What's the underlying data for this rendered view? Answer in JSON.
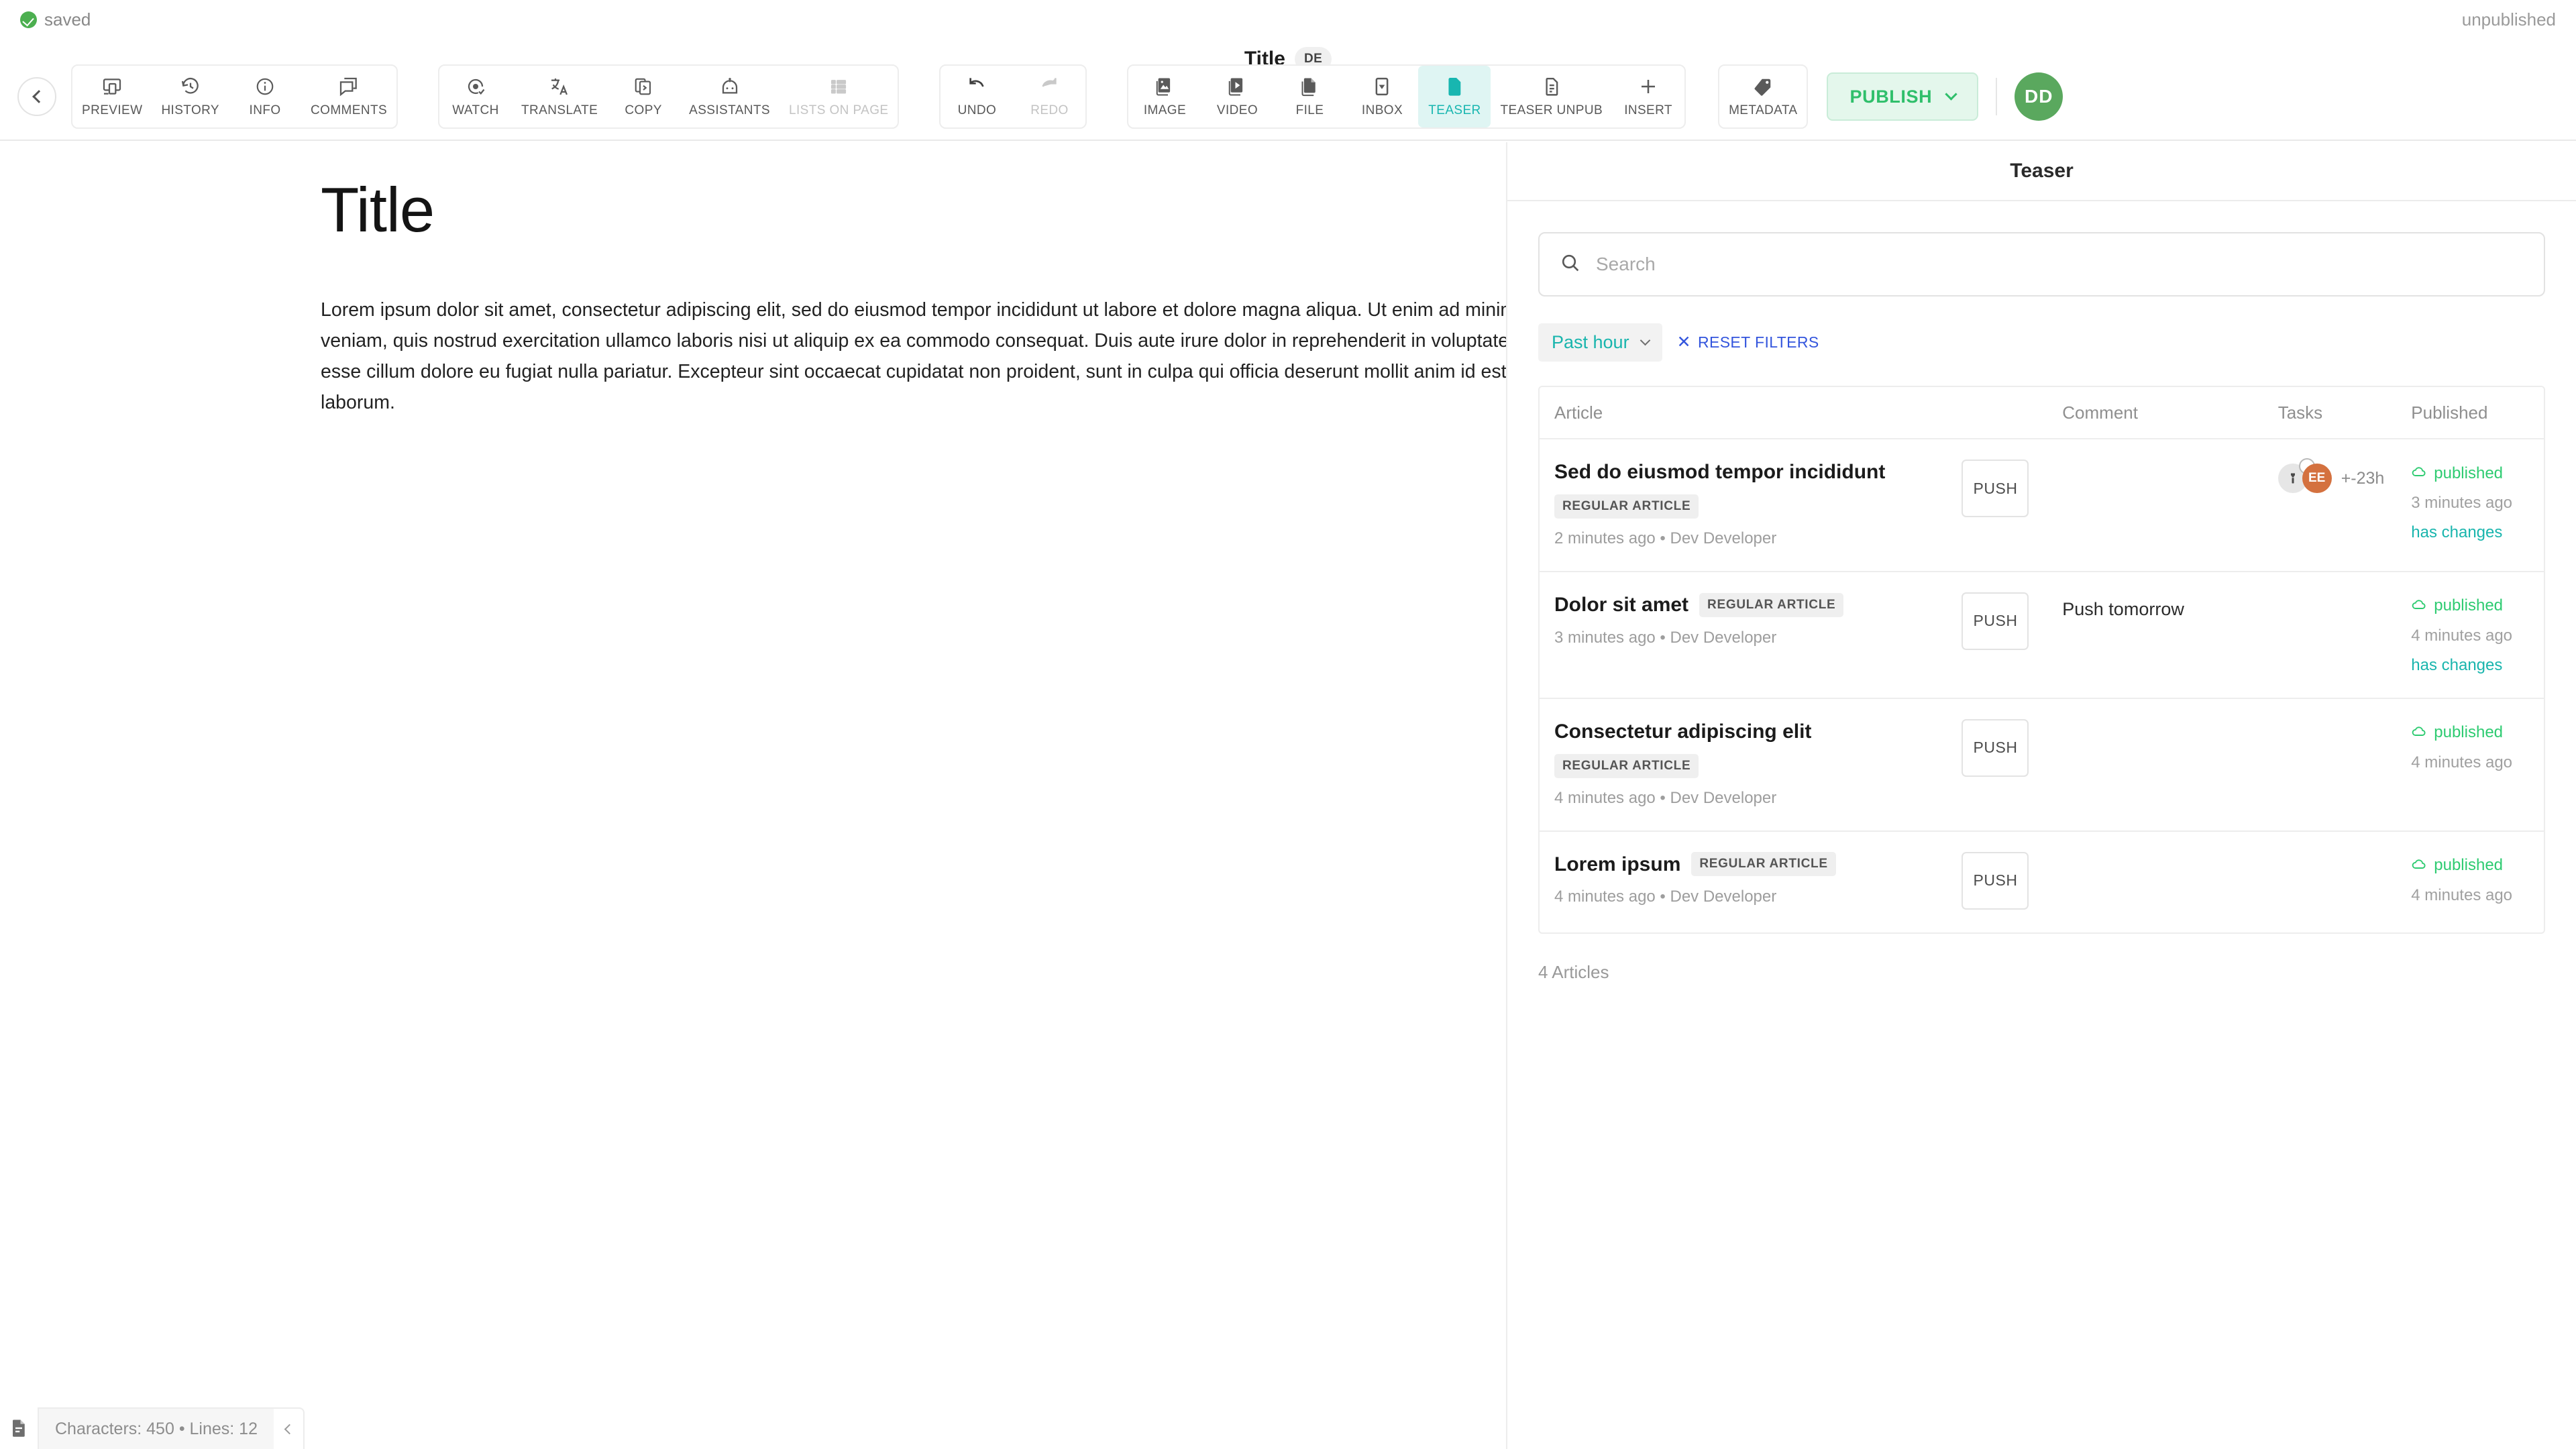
{
  "status": {
    "saved_label": "saved",
    "unpublished_label": "unpublished"
  },
  "document_header": {
    "title": "Title",
    "language_badge": "DE"
  },
  "toolbar": {
    "collapse_icon": "chevron-left-icon",
    "groups": [
      {
        "name": "document-tools",
        "items": [
          {
            "label": "PREVIEW",
            "icon": "preview-icon",
            "state": "enabled"
          },
          {
            "label": "HISTORY",
            "icon": "history-icon",
            "state": "enabled"
          },
          {
            "label": "INFO",
            "icon": "info-icon",
            "state": "enabled"
          },
          {
            "label": "COMMENTS",
            "icon": "comments-icon",
            "state": "enabled"
          }
        ]
      },
      {
        "name": "content-tools",
        "items": [
          {
            "label": "WATCH",
            "icon": "watch-icon",
            "state": "enabled"
          },
          {
            "label": "TRANSLATE",
            "icon": "translate-icon",
            "state": "enabled"
          },
          {
            "label": "COPY",
            "icon": "copy-icon",
            "state": "enabled"
          },
          {
            "label": "ASSISTANTS",
            "icon": "assistants-robot-icon",
            "state": "enabled"
          },
          {
            "label": "LISTS ON PAGE",
            "icon": "lists-icon",
            "state": "disabled"
          }
        ]
      },
      {
        "name": "history-tools",
        "items": [
          {
            "label": "UNDO",
            "icon": "undo-icon",
            "state": "enabled"
          },
          {
            "label": "REDO",
            "icon": "redo-icon",
            "state": "disabled"
          }
        ]
      },
      {
        "name": "insert-tools",
        "items": [
          {
            "label": "IMAGE",
            "icon": "image-icon",
            "state": "enabled"
          },
          {
            "label": "VIDEO",
            "icon": "video-icon",
            "state": "enabled"
          },
          {
            "label": "FILE",
            "icon": "file-icon",
            "state": "enabled"
          },
          {
            "label": "INBOX",
            "icon": "inbox-icon",
            "state": "enabled"
          },
          {
            "label": "TEASER",
            "icon": "teaser-icon",
            "state": "active"
          },
          {
            "label": "TEASER UNPUB",
            "icon": "teaser-unpub-icon",
            "state": "enabled"
          },
          {
            "label": "INSERT",
            "icon": "plus-icon",
            "state": "enabled"
          }
        ]
      },
      {
        "name": "metadata-tools",
        "items": [
          {
            "label": "METADATA",
            "icon": "tag-icon",
            "state": "enabled"
          }
        ]
      }
    ],
    "publish": {
      "label": "PUBLISH",
      "chevron_icon": "chevron-down-icon",
      "accent_color": "#2fbf6b",
      "background_color": "#e4f7ec"
    },
    "user_avatar": {
      "initials": "DD",
      "color": "#5aa85e"
    }
  },
  "editor": {
    "heading": "Title",
    "paragraph": "Lorem ipsum dolor sit amet, consectetur adipiscing elit, sed do eiusmod tempor incididunt ut labore et dolore magna aliqua. Ut enim ad minim veniam, quis nostrud exercitation ullamco laboris nisi ut aliquip ex ea commodo consequat. Duis aute irure dolor in reprehenderit in voluptate velit esse cillum dolore eu fugiat nulla pariatur. Excepteur sint occaecat cupidatat non proident, sunt in culpa qui officia deserunt mollit anim id est laborum."
  },
  "status_bar": {
    "icon": "document-icon",
    "text": "Characters: 450 • Lines: 12",
    "toggle_icon": "chevron-left-icon"
  },
  "panel": {
    "title": "Teaser",
    "search": {
      "placeholder": "Search",
      "value": "",
      "icon": "search-icon"
    },
    "filters": {
      "time_filter_label": "Past hour",
      "time_filter_chevron": "chevron-down-icon",
      "reset_label": "RESET FILTERS",
      "reset_icon": "close-x-icon",
      "time_filter_color": "#19b5ad",
      "reset_color": "#3355dd"
    },
    "table": {
      "columns": [
        "Article",
        "Comment",
        "Tasks",
        "Published"
      ],
      "rows": [
        {
          "title": "Sed do eiusmod tempor incididunt",
          "badge": "REGULAR ARTICLE",
          "meta": "2 minutes ago  •  Dev Developer",
          "push_label": "PUSH",
          "comment": "",
          "tasks": {
            "avatars": [
              {
                "type": "icon",
                "icon": "flashlight-icon",
                "background": "#e6e6e6",
                "ring": true
              },
              {
                "type": "initials",
                "initials": "EE",
                "background": "#d4713f",
                "ring": false
              }
            ],
            "eta": "+-23h"
          },
          "published": {
            "state": "published",
            "state_icon": "cloud-icon",
            "when": "3 minutes ago",
            "changes": "has changes"
          }
        },
        {
          "title": "Dolor sit amet",
          "badge": "REGULAR ARTICLE",
          "meta": "3 minutes ago  •  Dev Developer",
          "push_label": "PUSH",
          "comment": "Push tomorrow",
          "tasks": {
            "avatars": [],
            "eta": ""
          },
          "published": {
            "state": "published",
            "state_icon": "cloud-icon",
            "when": "4 minutes ago",
            "changes": "has changes"
          }
        },
        {
          "title": "Consectetur adipiscing elit",
          "badge": "REGULAR ARTICLE",
          "meta": "4 minutes ago  •  Dev Developer",
          "push_label": "PUSH",
          "comment": "",
          "tasks": {
            "avatars": [],
            "eta": ""
          },
          "published": {
            "state": "published",
            "state_icon": "cloud-icon",
            "when": "4 minutes ago",
            "changes": ""
          }
        },
        {
          "title": "Lorem ipsum",
          "badge": "REGULAR ARTICLE",
          "meta": "4 minutes ago  •  Dev Developer",
          "push_label": "PUSH",
          "comment": "",
          "tasks": {
            "avatars": [],
            "eta": ""
          },
          "published": {
            "state": "published",
            "state_icon": "cloud-icon",
            "when": "4 minutes ago",
            "changes": ""
          }
        }
      ],
      "count_label": "4 Articles"
    }
  }
}
